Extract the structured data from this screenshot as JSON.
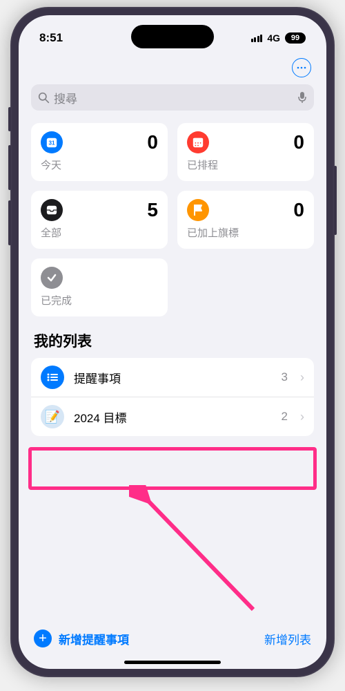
{
  "status": {
    "time": "8:51",
    "network": "4G",
    "battery": "99"
  },
  "search": {
    "placeholder": "搜尋"
  },
  "summary": {
    "today": {
      "label": "今天",
      "count": "0"
    },
    "scheduled": {
      "label": "已排程",
      "count": "0"
    },
    "all": {
      "label": "全部",
      "count": "5"
    },
    "flagged": {
      "label": "已加上旗標",
      "count": "0"
    },
    "completed": {
      "label": "已完成"
    }
  },
  "listsTitle": "我的列表",
  "lists": [
    {
      "name": "提醒事項",
      "count": "3"
    },
    {
      "name": "2024 目標",
      "count": "2"
    }
  ],
  "bottom": {
    "newReminder": "新增提醒事項",
    "newList": "新增列表"
  }
}
